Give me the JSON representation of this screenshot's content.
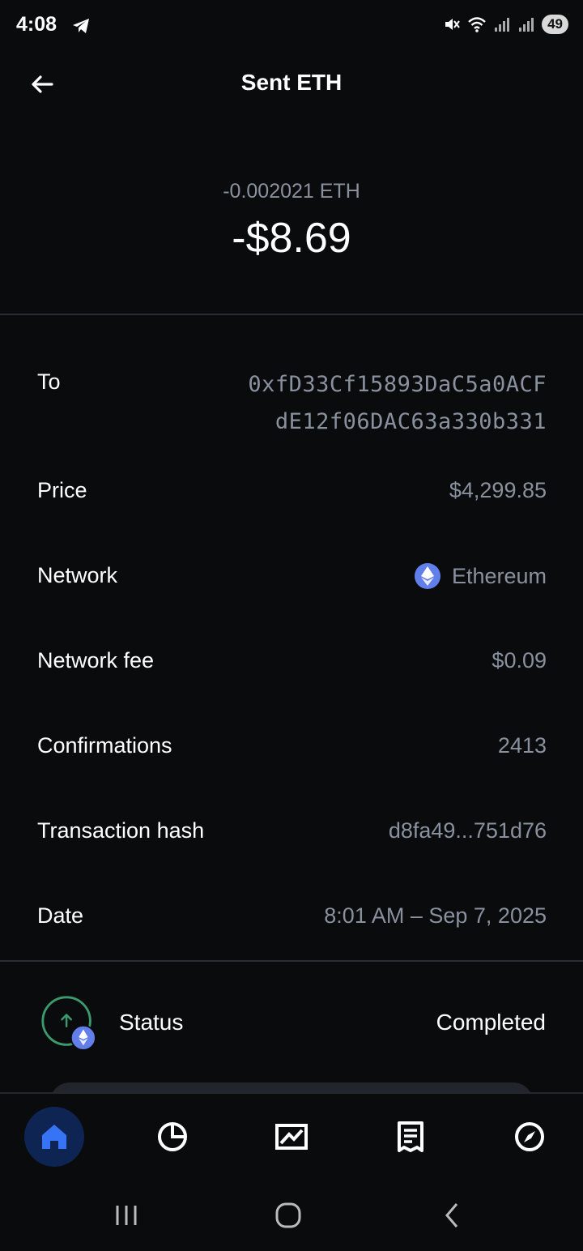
{
  "status_bar": {
    "time": "4:08",
    "battery": "49"
  },
  "header": {
    "title": "Sent ETH"
  },
  "amount": {
    "crypto": "-0.002021 ETH",
    "fiat": "-$8.69"
  },
  "details": {
    "to_label": "To",
    "to_line1": "0xfD33Cf15893DaC5a0ACF",
    "to_line2": "dE12f06DAC63a330b331",
    "price_label": "Price",
    "price_value": "$4,299.85",
    "network_label": "Network",
    "network_value": "Ethereum",
    "fee_label": "Network fee",
    "fee_value": "$0.09",
    "confirmations_label": "Confirmations",
    "confirmations_value": "2413",
    "hash_label": "Transaction hash",
    "hash_value": "d8fa49...751d76",
    "date_label": "Date",
    "date_value": "8:01 AM – Sep 7, 2025"
  },
  "status": {
    "label": "Status",
    "value": "Completed"
  },
  "colors": {
    "background": "#0a0b0d",
    "eth": "#627eea",
    "success": "#3c9a6e",
    "nav_active": "#0e2452",
    "secondary_text": "#8a919e"
  },
  "nav": {
    "active": "home-icon"
  }
}
